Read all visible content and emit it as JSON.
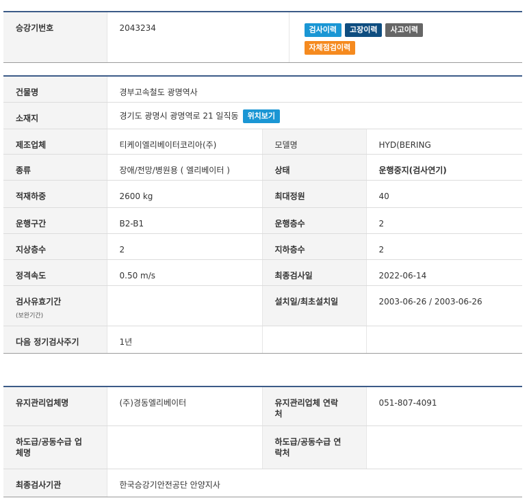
{
  "top": {
    "label": "승강기번호",
    "number": "2043234",
    "buttons": {
      "inspection": "검사이력",
      "failure": "고장이력",
      "accident": "사고이력",
      "self_check": "자체점검이력"
    }
  },
  "main": {
    "building_label": "건물명",
    "building_value": "경부고속철도 광명역사",
    "address_label": "소재지",
    "address_value": "경기도 광명시 광명역로 21 일직동",
    "map_button": "위치보기",
    "maker_label": "제조업체",
    "maker_value": "티케이엘리베이터코리아(주)",
    "model_label": "모델명",
    "model_value": "HYD(BERING",
    "kind_label": "종류",
    "kind_value": "장애/전망/병원용 ( 엘리베이터 )",
    "status_label": "상태",
    "status_value": "운행중지(검사연기)",
    "load_label": "적재하중",
    "load_value": "2600 kg",
    "capacity_label": "최대정원",
    "capacity_value": "40",
    "section_label": "운행구간",
    "section_value": "B2-B1",
    "floors_label": "운행층수",
    "floors_value": "2",
    "above_label": "지상층수",
    "above_value": "2",
    "below_label": "지하층수",
    "below_value": "2",
    "speed_label": "정격속도",
    "speed_value": "0.50 m/s",
    "last_insp_label": "최종검사일",
    "last_insp_value": "2022-06-14",
    "validity_label": "검사유효기간",
    "validity_sub": "(보완기간)",
    "validity_value": "",
    "install_label": "설치일/최초설치일",
    "install_value": "2003-06-26 / 2003-06-26",
    "cycle_label": "다음 정기검사주기",
    "cycle_value": "1년"
  },
  "maint": {
    "company_label": "유지관리업체명",
    "company_value": "(주)경동엘리베이터",
    "contact_label": "유지관리업체 연락처",
    "contact_value": "051-807-4091",
    "sub_label": "하도급/공동수급 업체명",
    "sub_value": "",
    "sub_contact_label": "하도급/공동수급 연락처",
    "sub_contact_value": "",
    "agency_label": "최종검사기관",
    "agency_value": "한국승강기안전공단 안양지사"
  }
}
